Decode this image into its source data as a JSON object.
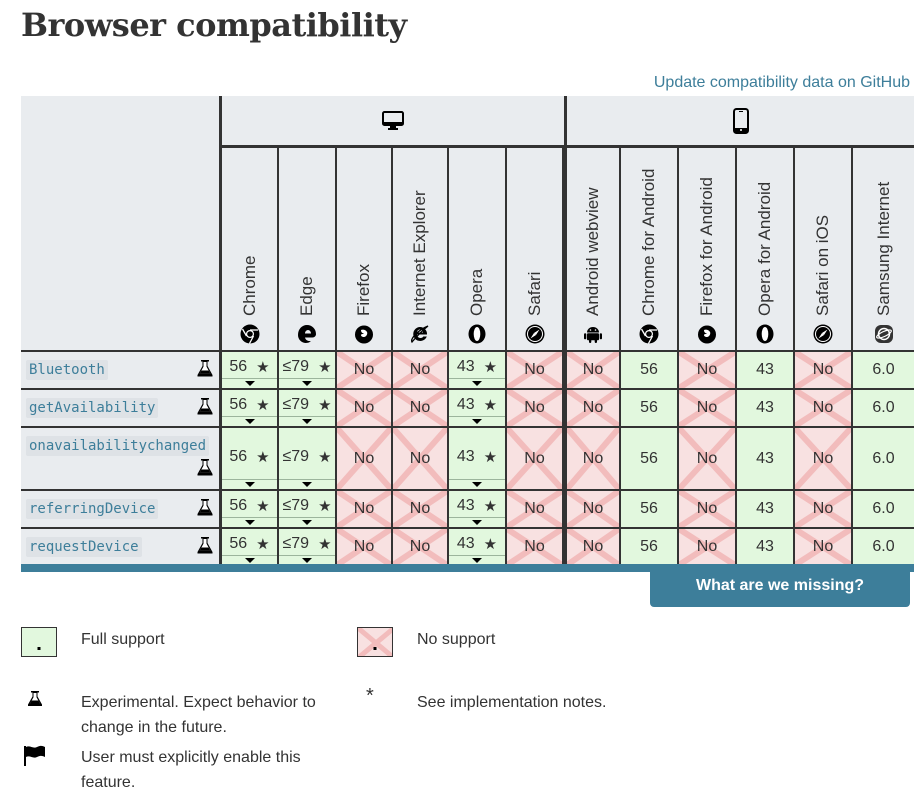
{
  "page": {
    "title": "Browser compatibility",
    "github_link": "Update compatibility data on GitHub"
  },
  "platforms": [
    {
      "name": "desktop",
      "icon": "desktop-icon"
    },
    {
      "name": "mobile",
      "icon": "mobile-icon"
    }
  ],
  "browsers": [
    {
      "name": "Chrome",
      "icon": "chrome-icon",
      "platform": "desktop"
    },
    {
      "name": "Edge",
      "icon": "edge-icon",
      "platform": "desktop"
    },
    {
      "name": "Firefox",
      "icon": "firefox-icon",
      "platform": "desktop"
    },
    {
      "name": "Internet Explorer",
      "icon": "ie-icon",
      "platform": "desktop"
    },
    {
      "name": "Opera",
      "icon": "opera-icon",
      "platform": "desktop"
    },
    {
      "name": "Safari",
      "icon": "safari-icon",
      "platform": "desktop"
    },
    {
      "name": "Android webview",
      "icon": "android-icon",
      "platform": "mobile"
    },
    {
      "name": "Chrome for Android",
      "icon": "chrome-icon",
      "platform": "mobile"
    },
    {
      "name": "Firefox for Android",
      "icon": "firefox-icon",
      "platform": "mobile"
    },
    {
      "name": "Opera for Android",
      "icon": "opera-icon",
      "platform": "mobile"
    },
    {
      "name": "Safari on iOS",
      "icon": "safari-icon",
      "platform": "mobile"
    },
    {
      "name": "Samsung Internet",
      "icon": "samsung-internet-icon",
      "platform": "mobile"
    }
  ],
  "features": [
    {
      "name": "Bluetooth",
      "experimental": true,
      "support": [
        {
          "value": "56",
          "status": "yes",
          "notes": true
        },
        {
          "value": "≤79",
          "status": "yes",
          "notes": true
        },
        {
          "value": "No",
          "status": "no"
        },
        {
          "value": "No",
          "status": "no"
        },
        {
          "value": "43",
          "status": "yes",
          "notes": true
        },
        {
          "value": "No",
          "status": "no"
        },
        {
          "value": "No",
          "status": "no"
        },
        {
          "value": "56",
          "status": "yes"
        },
        {
          "value": "No",
          "status": "no"
        },
        {
          "value": "43",
          "status": "yes"
        },
        {
          "value": "No",
          "status": "no"
        },
        {
          "value": "6.0",
          "status": "yes"
        }
      ]
    },
    {
      "name": "getAvailability",
      "experimental": true,
      "support": [
        {
          "value": "56",
          "status": "yes",
          "notes": true
        },
        {
          "value": "≤79",
          "status": "yes",
          "notes": true
        },
        {
          "value": "No",
          "status": "no"
        },
        {
          "value": "No",
          "status": "no"
        },
        {
          "value": "43",
          "status": "yes",
          "notes": true
        },
        {
          "value": "No",
          "status": "no"
        },
        {
          "value": "No",
          "status": "no"
        },
        {
          "value": "56",
          "status": "yes"
        },
        {
          "value": "No",
          "status": "no"
        },
        {
          "value": "43",
          "status": "yes"
        },
        {
          "value": "No",
          "status": "no"
        },
        {
          "value": "6.0",
          "status": "yes"
        }
      ]
    },
    {
      "name": "onavailabilitychanged",
      "experimental": true,
      "support": [
        {
          "value": "56",
          "status": "yes",
          "notes": true
        },
        {
          "value": "≤79",
          "status": "yes",
          "notes": true
        },
        {
          "value": "No",
          "status": "no"
        },
        {
          "value": "No",
          "status": "no"
        },
        {
          "value": "43",
          "status": "yes",
          "notes": true
        },
        {
          "value": "No",
          "status": "no"
        },
        {
          "value": "No",
          "status": "no"
        },
        {
          "value": "56",
          "status": "yes"
        },
        {
          "value": "No",
          "status": "no"
        },
        {
          "value": "43",
          "status": "yes"
        },
        {
          "value": "No",
          "status": "no"
        },
        {
          "value": "6.0",
          "status": "yes"
        }
      ]
    },
    {
      "name": "referringDevice",
      "experimental": true,
      "support": [
        {
          "value": "56",
          "status": "yes",
          "notes": true
        },
        {
          "value": "≤79",
          "status": "yes",
          "notes": true
        },
        {
          "value": "No",
          "status": "no"
        },
        {
          "value": "No",
          "status": "no"
        },
        {
          "value": "43",
          "status": "yes",
          "notes": true
        },
        {
          "value": "No",
          "status": "no"
        },
        {
          "value": "No",
          "status": "no"
        },
        {
          "value": "56",
          "status": "yes"
        },
        {
          "value": "No",
          "status": "no"
        },
        {
          "value": "43",
          "status": "yes"
        },
        {
          "value": "No",
          "status": "no"
        },
        {
          "value": "6.0",
          "status": "yes"
        }
      ]
    },
    {
      "name": "requestDevice",
      "experimental": true,
      "support": [
        {
          "value": "56",
          "status": "yes",
          "notes": true
        },
        {
          "value": "≤79",
          "status": "yes",
          "notes": true
        },
        {
          "value": "No",
          "status": "no"
        },
        {
          "value": "No",
          "status": "no"
        },
        {
          "value": "43",
          "status": "yes",
          "notes": true
        },
        {
          "value": "No",
          "status": "no"
        },
        {
          "value": "No",
          "status": "no"
        },
        {
          "value": "56",
          "status": "yes"
        },
        {
          "value": "No",
          "status": "no"
        },
        {
          "value": "43",
          "status": "yes"
        },
        {
          "value": "No",
          "status": "no"
        },
        {
          "value": "6.0",
          "status": "yes"
        }
      ]
    }
  ],
  "notes_symbol": "★",
  "missing_button": "What are we missing?",
  "legend": {
    "full_support": "Full support",
    "no_support": "No support",
    "experimental": "Experimental. Expect behavior to change in the future.",
    "implementation_notes": "See implementation notes.",
    "implementation_symbol": "*",
    "user_enable": "User must explicitly enable this feature."
  },
  "colors": {
    "accent": "#3d7e9a",
    "yes_bg": "#e2f8de",
    "no_bg": "#f8e1e1",
    "no_cross": "#f2bcbc",
    "header_bg": "#e9ecef"
  }
}
